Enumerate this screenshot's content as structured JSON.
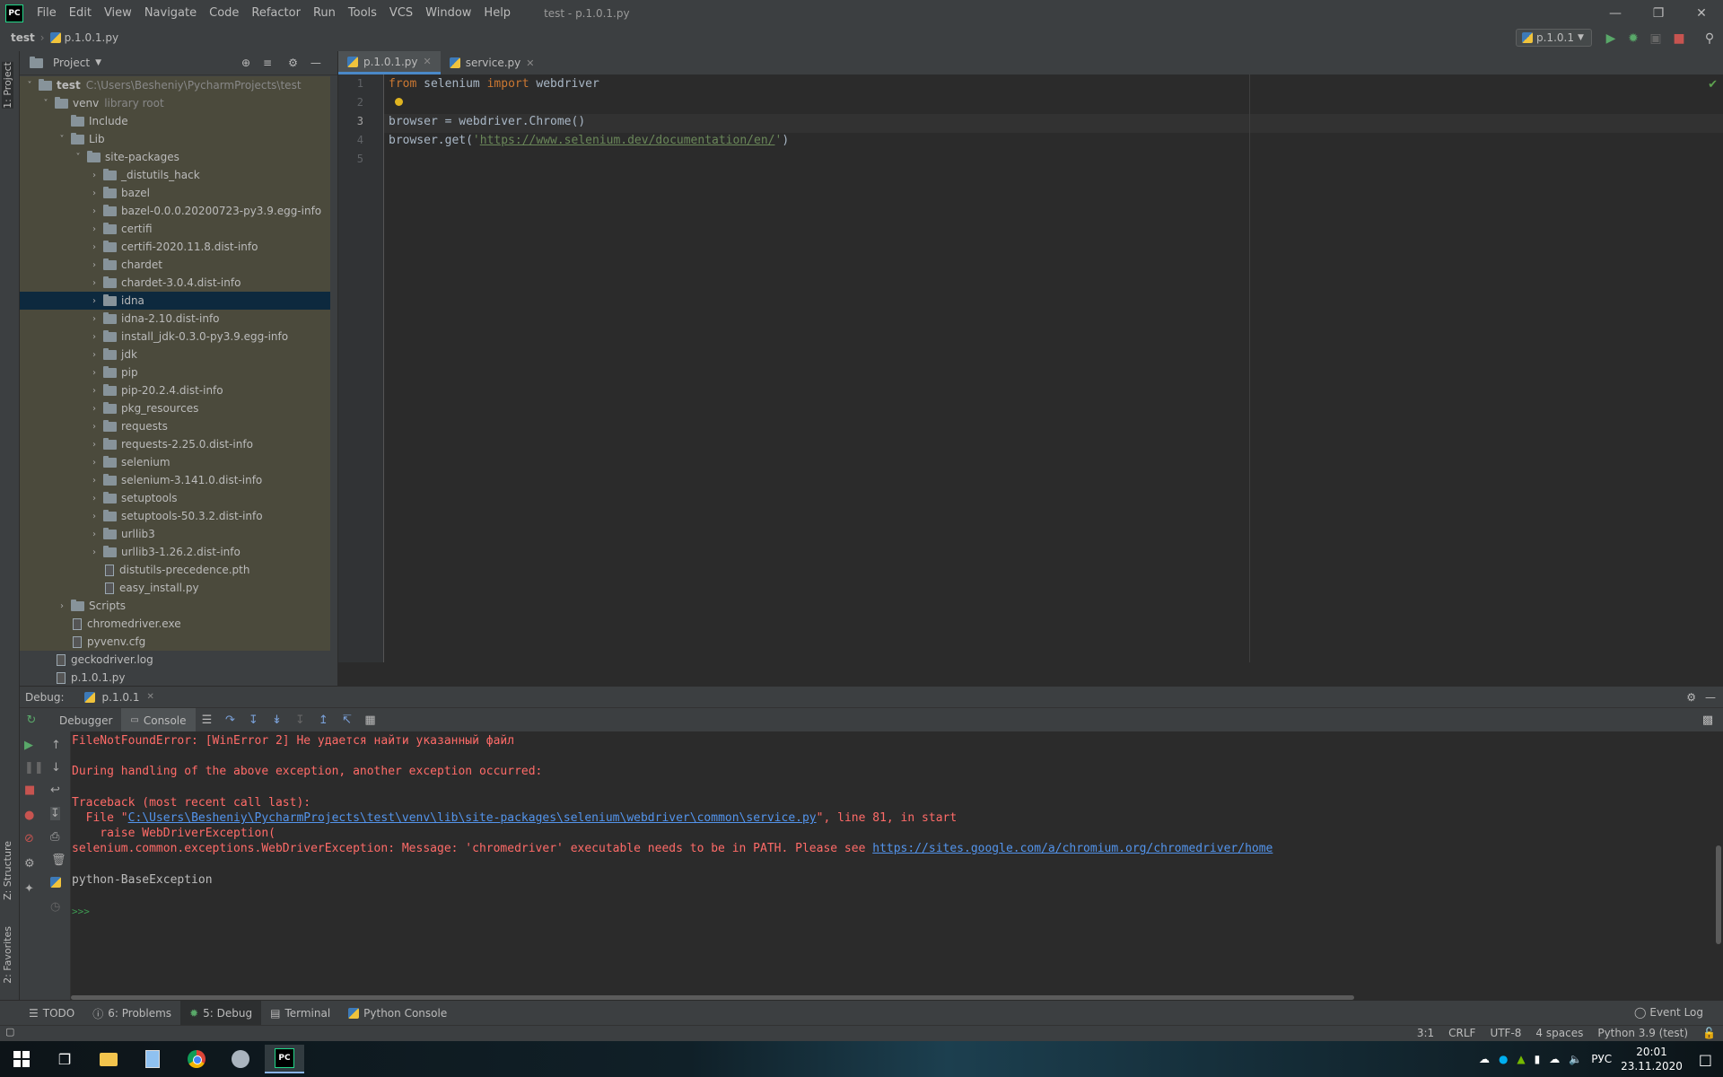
{
  "menubar": {
    "logo": "PC",
    "items": [
      "File",
      "Edit",
      "View",
      "Navigate",
      "Code",
      "Refactor",
      "Run",
      "Tools",
      "VCS",
      "Window",
      "Help"
    ],
    "window_title": "test - p.1.0.1.py"
  },
  "navbar": {
    "crumb_project": "test",
    "crumb_file": "p.1.0.1.py",
    "run_config": "p.1.0.1"
  },
  "left_stripe": {
    "project_tab": "1: Project",
    "structure_tab": "Z: Structure",
    "favorites_tab": "2: Favorites"
  },
  "project_panel": {
    "title": "Project",
    "tree": [
      {
        "label": "test",
        "hint": "C:\\Users\\Besheniy\\PycharmProjects\\test",
        "depth": 0,
        "type": "folder",
        "open": true
      },
      {
        "label": "venv",
        "hint": "library root",
        "depth": 1,
        "type": "folder",
        "open": true
      },
      {
        "label": "Include",
        "hint": "",
        "depth": 2,
        "type": "folder",
        "open": null
      },
      {
        "label": "Lib",
        "hint": "",
        "depth": 2,
        "type": "folder",
        "open": true
      },
      {
        "label": "site-packages",
        "hint": "",
        "depth": 3,
        "type": "folder",
        "open": true
      },
      {
        "label": "_distutils_hack",
        "hint": "",
        "depth": 4,
        "type": "folder",
        "open": false
      },
      {
        "label": "bazel",
        "hint": "",
        "depth": 4,
        "type": "folder",
        "open": false
      },
      {
        "label": "bazel-0.0.0.20200723-py3.9.egg-info",
        "hint": "",
        "depth": 4,
        "type": "folder",
        "open": false
      },
      {
        "label": "certifi",
        "hint": "",
        "depth": 4,
        "type": "folder",
        "open": false
      },
      {
        "label": "certifi-2020.11.8.dist-info",
        "hint": "",
        "depth": 4,
        "type": "folder",
        "open": false
      },
      {
        "label": "chardet",
        "hint": "",
        "depth": 4,
        "type": "folder",
        "open": false
      },
      {
        "label": "chardet-3.0.4.dist-info",
        "hint": "",
        "depth": 4,
        "type": "folder",
        "open": false
      },
      {
        "label": "idna",
        "hint": "",
        "depth": 4,
        "type": "folder",
        "open": false,
        "selected": true
      },
      {
        "label": "idna-2.10.dist-info",
        "hint": "",
        "depth": 4,
        "type": "folder",
        "open": false
      },
      {
        "label": "install_jdk-0.3.0-py3.9.egg-info",
        "hint": "",
        "depth": 4,
        "type": "folder",
        "open": false
      },
      {
        "label": "jdk",
        "hint": "",
        "depth": 4,
        "type": "folder",
        "open": false
      },
      {
        "label": "pip",
        "hint": "",
        "depth": 4,
        "type": "folder",
        "open": false
      },
      {
        "label": "pip-20.2.4.dist-info",
        "hint": "",
        "depth": 4,
        "type": "folder",
        "open": false
      },
      {
        "label": "pkg_resources",
        "hint": "",
        "depth": 4,
        "type": "folder",
        "open": false
      },
      {
        "label": "requests",
        "hint": "",
        "depth": 4,
        "type": "folder",
        "open": false
      },
      {
        "label": "requests-2.25.0.dist-info",
        "hint": "",
        "depth": 4,
        "type": "folder",
        "open": false
      },
      {
        "label": "selenium",
        "hint": "",
        "depth": 4,
        "type": "folder",
        "open": false
      },
      {
        "label": "selenium-3.141.0.dist-info",
        "hint": "",
        "depth": 4,
        "type": "folder",
        "open": false
      },
      {
        "label": "setuptools",
        "hint": "",
        "depth": 4,
        "type": "folder",
        "open": false
      },
      {
        "label": "setuptools-50.3.2.dist-info",
        "hint": "",
        "depth": 4,
        "type": "folder",
        "open": false
      },
      {
        "label": "urllib3",
        "hint": "",
        "depth": 4,
        "type": "folder",
        "open": false
      },
      {
        "label": "urllib3-1.26.2.dist-info",
        "hint": "",
        "depth": 4,
        "type": "folder",
        "open": false
      },
      {
        "label": "distutils-precedence.pth",
        "hint": "",
        "depth": 4,
        "type": "file",
        "open": null
      },
      {
        "label": "easy_install.py",
        "hint": "",
        "depth": 4,
        "type": "file",
        "open": null
      },
      {
        "label": "Scripts",
        "hint": "",
        "depth": 2,
        "type": "folder",
        "open": false
      },
      {
        "label": "chromedriver.exe",
        "hint": "",
        "depth": 2,
        "type": "file",
        "open": null
      },
      {
        "label": "pyvenv.cfg",
        "hint": "",
        "depth": 2,
        "type": "file",
        "open": null
      },
      {
        "label": "geckodriver.log",
        "hint": "",
        "depth": 1,
        "type": "file",
        "open": null
      },
      {
        "label": "p.1.0.1.py",
        "hint": "",
        "depth": 1,
        "type": "file",
        "open": null
      }
    ]
  },
  "editor": {
    "tabs": [
      {
        "label": "p.1.0.1.py",
        "active": true
      },
      {
        "label": "service.py",
        "active": false
      }
    ],
    "line_numbers": [
      "1",
      "2",
      "3",
      "4",
      "5"
    ],
    "line1": {
      "kw1": "from",
      "mod": " selenium ",
      "kw2": "import",
      "rest": " webdriver"
    },
    "line3": "browser = webdriver.Chrome()",
    "line4": {
      "pre": "browser.get(",
      "q1": "'",
      "url": "https://www.selenium.dev/documentation/en/",
      "q2": "'",
      "post": ")"
    }
  },
  "debug": {
    "label": "Debug:",
    "session": "p.1.0.1",
    "tabs": [
      "Debugger",
      "Console"
    ],
    "console": {
      "l1": "FileNotFoundError: [WinError 2] Не удается найти указанный файл",
      "l2": "During handling of the above exception, another exception occurred:",
      "l3": "Traceback (most recent call last):",
      "l4_pre": "  File \"",
      "l4_link": "C:\\Users\\Besheniy\\PycharmProjects\\test\\venv\\lib\\site-packages\\selenium\\webdriver\\common\\service.py",
      "l4_post": "\", line 81, in start",
      "l5": "    raise WebDriverException(",
      "l6_pre": "selenium.common.exceptions.WebDriverException: Message: 'chromedriver' executable needs to be in PATH. Please see ",
      "l6_link": "https://sites.google.com/a/chromium.org/chromedriver/home",
      "l7": "python-BaseException",
      "prompt": ">>>"
    }
  },
  "tooltabs": {
    "items": [
      "TODO",
      "6: Problems",
      "5: Debug",
      "Terminal",
      "Python Console"
    ],
    "event_log": "Event Log"
  },
  "status": {
    "position": "3:1",
    "line_sep": "CRLF",
    "encoding": "UTF-8",
    "indent": "4 spaces",
    "interpreter": "Python 3.9 (test)"
  },
  "taskbar": {
    "lang": "РУС",
    "time": "20:01",
    "date": "23.11.2020"
  },
  "colors": {
    "accent": "#4a88c7",
    "error_text": "#ff6b68",
    "link": "#5394ec",
    "keyword": "#cc7832",
    "string": "#6a8759"
  }
}
